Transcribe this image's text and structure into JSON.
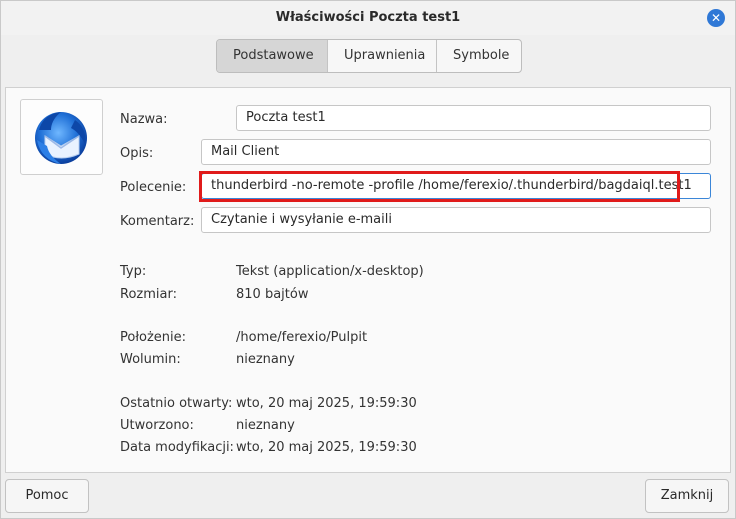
{
  "window": {
    "title": "Właściwości Poczta test1"
  },
  "tabs": [
    {
      "label": "Podstawowe",
      "active": true
    },
    {
      "label": "Uprawnienia",
      "active": false
    },
    {
      "label": "Symbole",
      "active": false
    }
  ],
  "app_icon": "thunderbird-icon",
  "form": {
    "name_label": "Nazwa:",
    "name_value": "Poczta test1",
    "comment_short_label": "Opis:",
    "comment_short_value": "Mail Client",
    "command_label": "Polecenie:",
    "command_value": "thunderbird -no-remote -profile /home/ferexio/.thunderbird/bagdaiql.test1",
    "comment_label": "Komentarz:",
    "comment_value": "Czytanie i wysyłanie e-maili"
  },
  "info": {
    "type_label": "Typ:",
    "type_value": "Tekst (application/x-desktop)",
    "size_label": "Rozmiar:",
    "size_value": "810 bajtów",
    "location_label": "Położenie:",
    "location_value": "/home/ferexio/Pulpit",
    "volume_label": "Wolumin:",
    "volume_value": "nieznany",
    "accessed_label": "Ostatnio otwarty:",
    "accessed_value": "wto, 20 maj 2025, 19:59:30",
    "created_label": "Utworzono:",
    "created_value": "nieznany",
    "modified_label": "Data modyfikacji:",
    "modified_value": "wto, 20 maj 2025, 19:59:30"
  },
  "buttons": {
    "help_label": "Pomoc",
    "close_label": "Zamknij"
  },
  "colors": {
    "accent": "#2f78d6",
    "highlight": "#e01b1b"
  }
}
